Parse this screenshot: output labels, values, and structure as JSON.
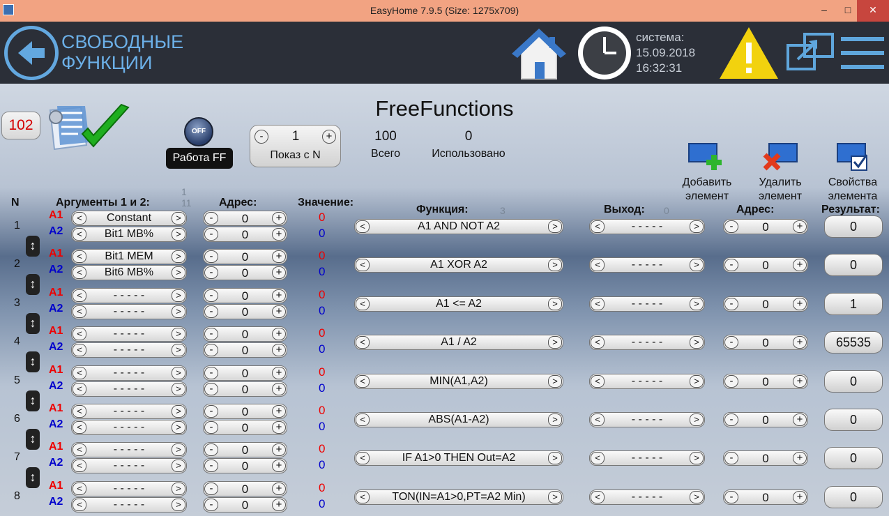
{
  "window": {
    "title": "EasyHome 7.9.5 (Size: 1275x709)",
    "min": "–",
    "max": "□",
    "close": "✕"
  },
  "header": {
    "title_line1": "СВОБОДНЫЕ",
    "title_line2": "ФУНКЦИИ",
    "system_label": "система:",
    "date": "15.09.2018",
    "time": "16:32:31"
  },
  "toolbar": {
    "count": "102",
    "app_title": "FreeFunctions",
    "off_label": "OFF",
    "ff_label": "Работа FF",
    "show_value": "1",
    "show_label": "Показ с N",
    "total_value": "100",
    "total_label": "Всего",
    "used_value": "0",
    "used_label": "Использовано",
    "add_label_1": "Добавить",
    "add_label_2": "элемент",
    "delete_label_1": "Удалить",
    "delete_label_2": "элемент",
    "props_label_1": "Свойства",
    "props_label_2": "элемента"
  },
  "columns": {
    "n": "N",
    "args": "Аргументы 1 и 2:",
    "args_sub_1": "1",
    "args_sub_2": "11",
    "address": "Адрес:",
    "value": "Значение:",
    "function": "Функция:",
    "function_sub": "3",
    "output": "Выход:",
    "output_sub": "0",
    "out_address": "Адрес:",
    "result": "Результат:"
  },
  "labels": {
    "a1": "A1",
    "a2": "A2",
    "minus": "-",
    "plus": "+",
    "left": "<",
    "right": ">",
    "move": "↕"
  },
  "rows": [
    {
      "n": "1",
      "arg1": "Constant",
      "arg2": "Bit1 MB%",
      "addr1": "0",
      "addr2": "0",
      "val1": "0",
      "val2": "0",
      "func": "A1 AND NOT A2",
      "out": "- - - - -",
      "out_addr": "0",
      "result": "0"
    },
    {
      "n": "2",
      "arg1": "Bit1 MEM",
      "arg2": "Bit6 MB%",
      "addr1": "0",
      "addr2": "0",
      "val1": "0",
      "val2": "0",
      "func": "A1 XOR A2",
      "out": "- - - - -",
      "out_addr": "0",
      "result": "0"
    },
    {
      "n": "3",
      "arg1": "- - - - -",
      "arg2": "- - - - -",
      "addr1": "0",
      "addr2": "0",
      "val1": "0",
      "val2": "0",
      "func": "A1 <= A2",
      "out": "- - - - -",
      "out_addr": "0",
      "result": "1"
    },
    {
      "n": "4",
      "arg1": "- - - - -",
      "arg2": "- - - - -",
      "addr1": "0",
      "addr2": "0",
      "val1": "0",
      "val2": "0",
      "func": "A1 / A2",
      "out": "- - - - -",
      "out_addr": "0",
      "result": "65535"
    },
    {
      "n": "5",
      "arg1": "- - - - -",
      "arg2": "- - - - -",
      "addr1": "0",
      "addr2": "0",
      "val1": "0",
      "val2": "0",
      "func": "MIN(A1,A2)",
      "out": "- - - - -",
      "out_addr": "0",
      "result": "0"
    },
    {
      "n": "6",
      "arg1": "- - - - -",
      "arg2": "- - - - -",
      "addr1": "0",
      "addr2": "0",
      "val1": "0",
      "val2": "0",
      "func": "ABS(A1-A2)",
      "out": "- - - - -",
      "out_addr": "0",
      "result": "0"
    },
    {
      "n": "7",
      "arg1": "- - - - -",
      "arg2": "- - - - -",
      "addr1": "0",
      "addr2": "0",
      "val1": "0",
      "val2": "0",
      "func": "IF A1>0 THEN Out=A2",
      "out": "- - - - -",
      "out_addr": "0",
      "result": "0"
    },
    {
      "n": "8",
      "arg1": "- - - - -",
      "arg2": "- - - - -",
      "addr1": "0",
      "addr2": "0",
      "val1": "0",
      "val2": "0",
      "func": "TON(IN=A1>0,PT=A2 Min)",
      "out": "- - - - -",
      "out_addr": "0",
      "result": "0"
    }
  ]
}
